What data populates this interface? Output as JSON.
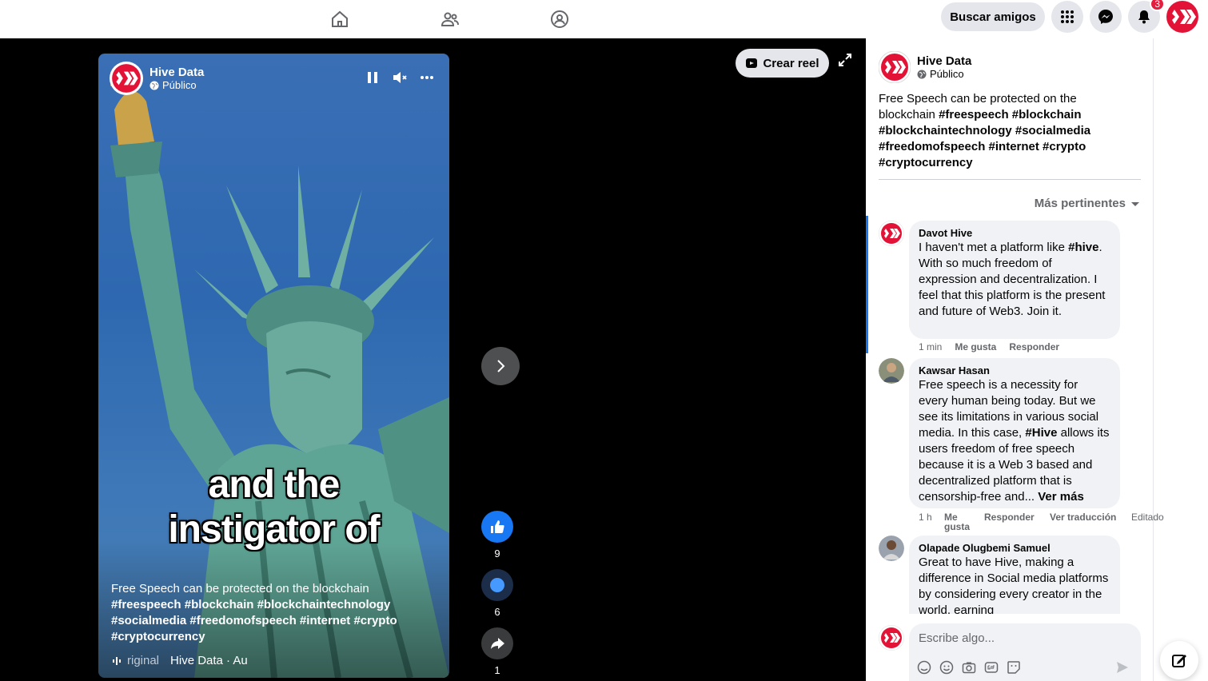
{
  "nav": {
    "icons": [
      "home-icon",
      "friends-icon",
      "groups-icon"
    ],
    "find_friends": "Buscar amigos",
    "notifications_count": "3"
  },
  "reel": {
    "author": "Hive Data",
    "audience": "Público",
    "overlay_text_1": "and the",
    "overlay_text_2": "instigator of",
    "description_plain": "Free Speech can be protected on the blockchain",
    "description_tags": "#freespeech #blockchain #blockchaintechnology #socialmedia #freedomofspeech #internet #crypto #cryptocurrency",
    "audio_label": "riginal",
    "audio_author": "Hive Data · Au",
    "create_reel": "Crear reel",
    "likes": "9",
    "comments": "6",
    "shares": "1"
  },
  "panel": {
    "author": "Hive Data",
    "audience": "Público",
    "desc_plain": "Free Speech can be protected on the blockchain",
    "desc_tags": "#freespeech #blockchain #blockchaintechnology #socialmedia #freedomofspeech #internet #crypto #cryptocurrency",
    "sort": "Más pertinentes",
    "comments": [
      {
        "name": "Davot Hive",
        "text_a": "I haven't met a platform like ",
        "tag": "#hive",
        "text_b": ". With so much freedom of expression and decentralization. I feel that this platform is the present and future of Web3. Join it.",
        "time": "1 min",
        "like": "Me gusta",
        "reply": "Responder"
      },
      {
        "name": "Kawsar Hasan",
        "text_a": "Free speech is a necessity for every human being today. But we see its limitations in various social media. In this case, ",
        "tag": "#Hive",
        "text_b": " allows its users freedom of free speech because it is a Web 3 based and decentralized platform that is censorship-free and... ",
        "more": "Ver más",
        "time": "1 h",
        "like": "Me gusta",
        "reply": "Responder",
        "translate": "Ver traducción",
        "edited": "Editado"
      },
      {
        "name": "Olapade Olugbemi Samuel",
        "text": "Great to have Hive, making a difference in Social media platforms by considering every creator in the world, earning"
      }
    ],
    "composer_placeholder": "Escribe algo..."
  },
  "colors": {
    "hive_red": "#e31337",
    "fb_blue": "#1877f2",
    "bubble": "#f0f2f5"
  }
}
